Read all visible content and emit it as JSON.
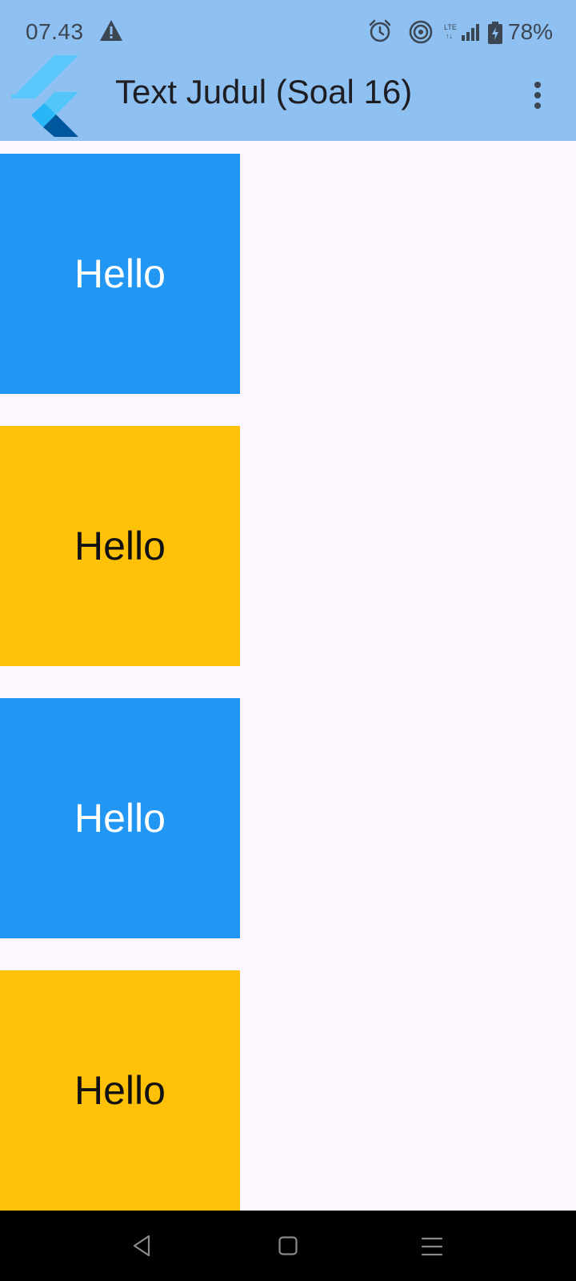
{
  "status_bar": {
    "time": "07.43",
    "battery": "78%",
    "icons": [
      "warning-icon",
      "alarm-icon",
      "hotspot-icon",
      "lte-signal-icon",
      "battery-charging-icon"
    ]
  },
  "app_bar": {
    "title": "Text Judul (Soal 16)",
    "logo": "flutter-logo",
    "menu_icon": "more-vert-icon"
  },
  "tiles": [
    {
      "label": "Hello",
      "color": "#2196f3"
    },
    {
      "label": "Hello",
      "color": "#ffc107"
    },
    {
      "label": "Hello",
      "color": "#2196f3"
    },
    {
      "label": "Hello",
      "color": "#ffc107"
    }
  ],
  "nav_bar": {
    "icons": [
      "back-icon",
      "home-icon",
      "recents-icon"
    ]
  },
  "colors": {
    "app_bar": "#8ec0f2",
    "background": "#fdf7fd",
    "blue": "#2196f3",
    "amber": "#ffc107"
  }
}
